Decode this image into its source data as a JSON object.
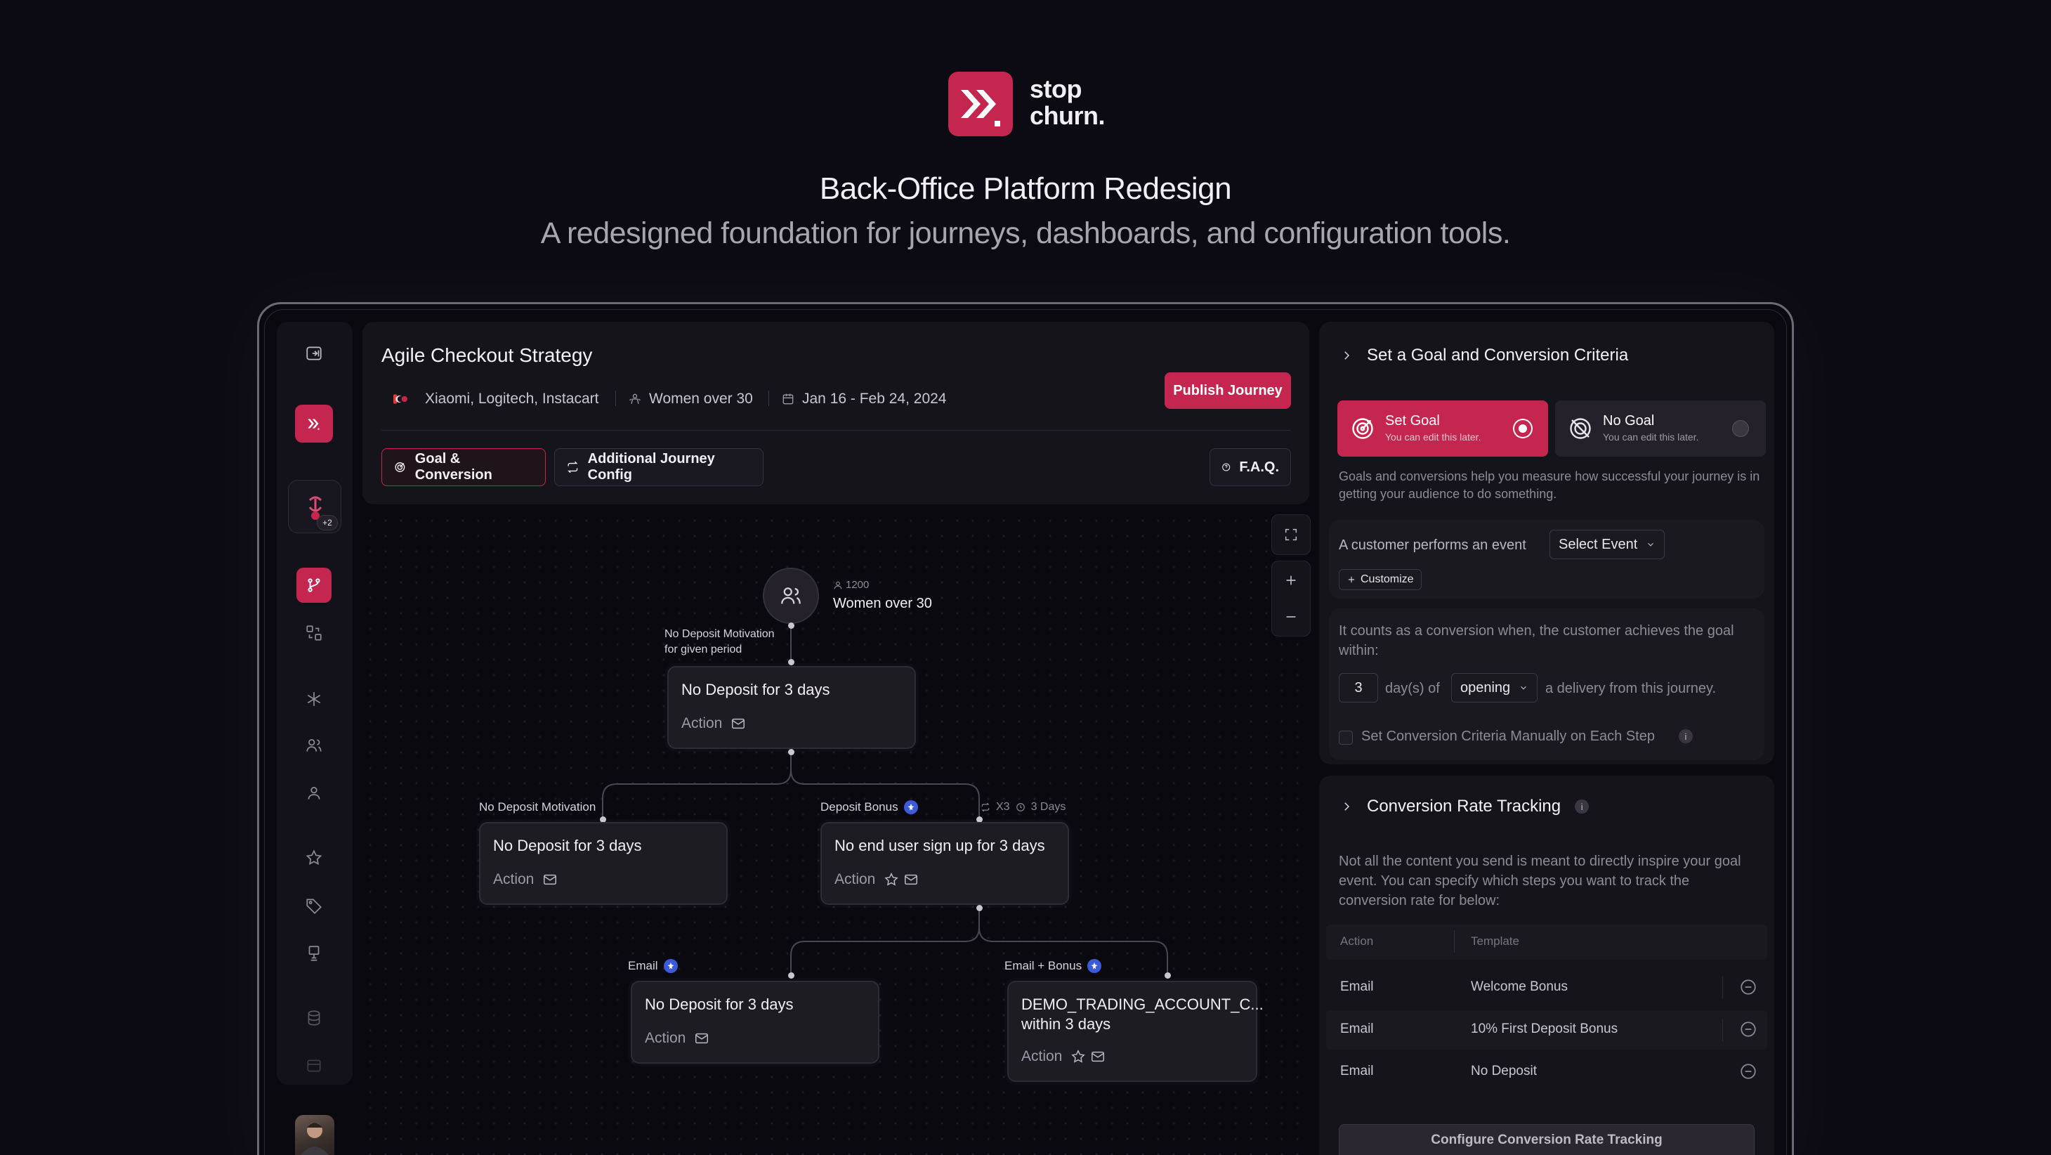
{
  "brand": {
    "name_line1": "stop",
    "name_line2": "churn.",
    "accent": "#c4264f"
  },
  "hero": {
    "title": "Back-Office Platform Redesign",
    "subtitle": "A redesigned foundation for journeys, dashboards, and configuration tools."
  },
  "rail": {
    "badge": "+2",
    "icons": [
      "collapse-icon",
      "brand-icon",
      "journey-icon",
      "flows-icon",
      "asterisk-icon",
      "users-icon",
      "user-icon",
      "star-icon",
      "tag-icon",
      "monitor-icon",
      "database-icon",
      "archive-icon"
    ]
  },
  "journey": {
    "title": "Agile Checkout Strategy",
    "brands": "Xiaomi, Logitech, Instacart",
    "audience": "Women over 30",
    "dates": "Jan 16 - Feb 24, 2024",
    "publish_label": "Publish Journey",
    "tabs": [
      "Goal & Conversion",
      "Additional Journey Config"
    ],
    "faq_label": "F.A.Q."
  },
  "flow": {
    "root": {
      "count": "1200",
      "label": "Women over 30"
    },
    "edge_root": "No Deposit Motivation\nfor given period",
    "nodes": [
      {
        "title": "No Deposit for 3 days",
        "action": "Action"
      },
      {
        "title": "No Deposit for 3 days",
        "action": "Action"
      },
      {
        "title": "No end user sign up for 3 days",
        "action": "Action"
      },
      {
        "title": "No Deposit for 3 days",
        "action": "Action"
      },
      {
        "title": "DEMO_TRADING_ACCOUNT_C...\nwithin 3 days",
        "action": "Action"
      }
    ],
    "edges": {
      "left": "No Deposit Motivation",
      "right": "Deposit Bonus",
      "right_repeat": "X3",
      "right_wait": "3 Days",
      "email": "Email",
      "email_bonus": "Email + Bonus"
    }
  },
  "goal_panel": {
    "title": "Set a Goal and Conversion Criteria",
    "set_goal": {
      "title": "Set Goal",
      "sub": "You can edit this later."
    },
    "no_goal": {
      "title": "No Goal",
      "sub": "You can edit this later."
    },
    "description": "Goals and conversions help you measure how successful your journey is in getting your audience to do something.",
    "event_prefix": "A customer performs an event",
    "event_select": "Select Event",
    "customize": "Customize",
    "conversion_text": "It counts as a conversion when, the customer achieves the goal within:",
    "days_value": "3",
    "days_of": "day(s) of",
    "opening_select": "opening",
    "delivery_text": "a delivery from this journey.",
    "manual_checkbox": "Set Conversion Criteria Manually on Each Step"
  },
  "tracking_panel": {
    "title": "Conversion Rate Tracking",
    "description": "Not all the content you send is meant to directly inspire your goal event.  You can specify which steps you want to track the conversion rate for below:",
    "col_action": "Action",
    "col_template": "Template",
    "rows": [
      {
        "action": "Email",
        "template": "Welcome Bonus"
      },
      {
        "action": "Email",
        "template": "10% First Deposit Bonus"
      },
      {
        "action": "Email",
        "template": "No Deposit"
      }
    ],
    "configure_label": "Configure Conversion Rate Tracking"
  }
}
